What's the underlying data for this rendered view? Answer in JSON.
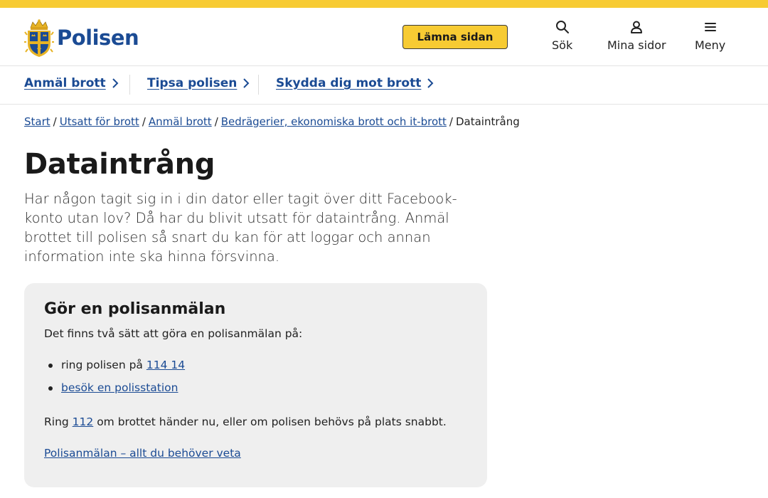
{
  "header": {
    "logo_text": "Polisen",
    "leave_label": "Lämna sidan",
    "actions": [
      {
        "label": "Sök",
        "icon": "search-icon"
      },
      {
        "label": "Mina sidor",
        "icon": "user-icon"
      },
      {
        "label": "Meny",
        "icon": "hamburger-menu-icon"
      }
    ]
  },
  "quicknav": {
    "items": [
      {
        "label": "Anmäl brott"
      },
      {
        "label": "Tipsa polisen"
      },
      {
        "label": "Skydda dig mot brott"
      }
    ]
  },
  "breadcrumb": {
    "items": [
      "Start",
      "Utsatt för brott",
      "Anmäl brott",
      "Bedrägerier, ekonomiska brott och it-brott"
    ],
    "current": "Dataintrång",
    "separator": "/"
  },
  "page": {
    "title": "Dataintrång",
    "lead": "Har någon tagit sig in i din dator eller tagit över ditt Facebook-konto utan lov? Då har du blivit utsatt för dataintrång. Anmäl brottet till polisen så snart du kan för att loggar och annan information inte ska hinna försvinna."
  },
  "report_card": {
    "title": "Gör en polisanmälan",
    "intro": "Det finns två sätt att göra en polisanmälan på:",
    "option_call_prefix": "ring polisen på ",
    "option_call_number": "114 14",
    "option_visit": "besök en polisstation",
    "emergency_prefix": "Ring ",
    "emergency_number": "112",
    "emergency_suffix": " om brottet händer nu, eller om polisen behövs på plats snabbt.",
    "guide_link": "Polisanmälan – allt du behöver veta"
  },
  "colors": {
    "brand_blue": "#1b4b94",
    "accent_yellow": "#f7cb33",
    "card_bg": "#efefef"
  }
}
